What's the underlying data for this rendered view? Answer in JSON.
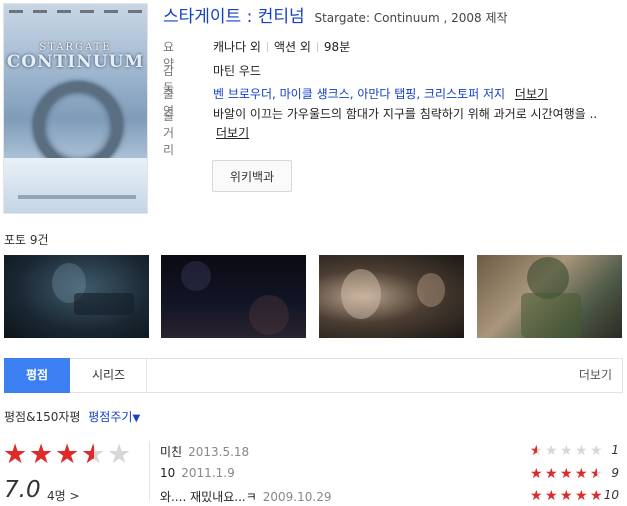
{
  "movie": {
    "title": "스타게이트 : 컨티넘",
    "subtitle": "Stargate: Continuum , 2008 제작",
    "poster": {
      "title_line1": "STARGATE",
      "title_line2": "CONTINUUM"
    }
  },
  "info": {
    "summary_label": "요약",
    "summary": [
      "캐나다 외",
      "액션 외",
      "98분"
    ],
    "director_label": "감독",
    "director": "마틴 우드",
    "cast_label": "출연",
    "cast": "벤 브로우더, 마이클 섕크스, 아만다 탭핑, 크리스토퍼 저지",
    "cast_more": "더보기",
    "plot_label": "줄거리",
    "plot": "바알이 이끄는 가우울드의 함대가 지구를 침략하기 위해 과거로 시간여행을 ..",
    "plot_more": "더보기",
    "wiki_button": "위키백과"
  },
  "photos": {
    "label": "포토 9건",
    "count": 4
  },
  "tabs": {
    "items": [
      "평점",
      "시리즈"
    ],
    "active": "평점",
    "more": "더보기"
  },
  "rating": {
    "header": "평점&150자평",
    "give": "평점주기",
    "stars_value": 3.5,
    "stars_max": 5,
    "score": "7.0",
    "count": "4명 >",
    "reviews": [
      {
        "text": "미친",
        "date": "2013.5.18",
        "score": "1",
        "stars": 0.5
      },
      {
        "text": "10",
        "date": "2011.1.9",
        "score": "9",
        "stars": 4.5
      },
      {
        "text": "와.... 재밌내요...ㅋ",
        "date": "2009.10.29",
        "score": "10",
        "stars": 5
      }
    ]
  },
  "colors": {
    "link": "#1440c8",
    "accent_tab": "#3b7ff3",
    "star_filled": "#e02a2a",
    "star_empty": "#d7d7d7"
  }
}
